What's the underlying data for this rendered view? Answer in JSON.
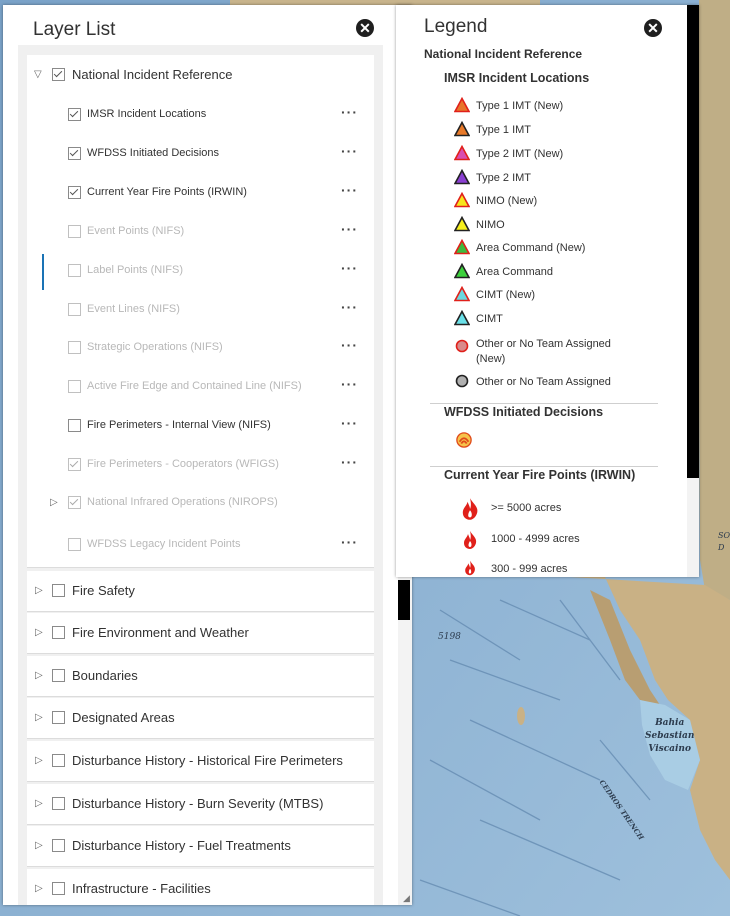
{
  "layer_list": {
    "title": "Layer List",
    "close_icon": "close-icon",
    "root": {
      "label": "National Incident Reference",
      "checked": true,
      "expanded": true,
      "children": [
        {
          "label": "IMSR Incident Locations",
          "checked": true,
          "dim": false,
          "menu": true
        },
        {
          "label": "WFDSS Initiated Decisions",
          "checked": true,
          "dim": false,
          "menu": true
        },
        {
          "label": "Current Year Fire Points (IRWIN)",
          "checked": true,
          "dim": false,
          "menu": true
        },
        {
          "label": "Event Points (NIFS)",
          "checked": false,
          "dim": true,
          "menu": true
        },
        {
          "label": "Label Points (NIFS)",
          "checked": false,
          "dim": true,
          "menu": true
        },
        {
          "label": "Event Lines (NIFS)",
          "checked": false,
          "dim": true,
          "menu": true
        },
        {
          "label": "Strategic Operations (NIFS)",
          "checked": false,
          "dim": true,
          "menu": true
        },
        {
          "label": "Active Fire Edge and Contained Line (NIFS)",
          "checked": false,
          "dim": true,
          "menu": true
        },
        {
          "label": "Fire Perimeters - Internal View (NIFS)",
          "checked": false,
          "dim": false,
          "menu": true
        },
        {
          "label": "Fire Perimeters - Cooperators (WFIGS)",
          "checked": true,
          "dim": true,
          "menu": true
        },
        {
          "label": "National Infrared Operations (NIROPS)",
          "checked": true,
          "dim": true,
          "menu": false
        },
        {
          "label": "WFDSS Legacy Incident Points",
          "checked": false,
          "dim": true,
          "menu": true
        }
      ]
    },
    "groups": [
      {
        "label": "Fire Safety"
      },
      {
        "label": "Fire Environment and Weather"
      },
      {
        "label": "Boundaries"
      },
      {
        "label": "Designated Areas"
      },
      {
        "label": "Disturbance History - Historical Fire Perimeters"
      },
      {
        "label": "Disturbance History - Burn Severity (MTBS)"
      },
      {
        "label": "Disturbance History - Fuel Treatments"
      },
      {
        "label": "Infrastructure - Facilities"
      }
    ],
    "menu_glyph": "···"
  },
  "legend": {
    "title": "Legend",
    "section": "National Incident Reference",
    "imsr": {
      "heading": "IMSR Incident Locations",
      "items": [
        {
          "label": "Type 1 IMT (New)",
          "fill": "#e8742a",
          "stroke": "#e0201a",
          "shape": "triangle"
        },
        {
          "label": "Type 1 IMT",
          "fill": "#e87a2a",
          "stroke": "#222222",
          "shape": "triangle"
        },
        {
          "label": "Type 2 IMT (New)",
          "fill": "#d94db0",
          "stroke": "#e0201a",
          "shape": "triangle"
        },
        {
          "label": "Type 2 IMT",
          "fill": "#8a3fd1",
          "stroke": "#222222",
          "shape": "triangle"
        },
        {
          "label": "NIMO (New)",
          "fill": "#f7e41c",
          "stroke": "#e0201a",
          "shape": "triangle"
        },
        {
          "label": "NIMO",
          "fill": "#f7f01c",
          "stroke": "#222222",
          "shape": "triangle"
        },
        {
          "label": "Area Command (New)",
          "fill": "#3dbb3d",
          "stroke": "#e0201a",
          "shape": "triangle"
        },
        {
          "label": "Area Command",
          "fill": "#3dd13d",
          "stroke": "#222222",
          "shape": "triangle"
        },
        {
          "label": "CIMT (New)",
          "fill": "#6ad9e0",
          "stroke": "#e0201a",
          "shape": "triangle"
        },
        {
          "label": "CIMT",
          "fill": "#6ae0e8",
          "stroke": "#222222",
          "shape": "triangle"
        },
        {
          "label": "Other or No Team Assigned (New)",
          "fill": "#d98a8a",
          "stroke": "#e0201a",
          "shape": "circle"
        },
        {
          "label": "Other or No Team Assigned",
          "fill": "#b0b0b0",
          "stroke": "#222222",
          "shape": "circle"
        }
      ]
    },
    "wfdss": {
      "heading": "WFDSS Initiated Decisions",
      "icon": "wfdss-decision-icon"
    },
    "irwin": {
      "heading": "Current Year Fire Points (IRWIN)",
      "items": [
        {
          "label": ">= 5000 acres"
        },
        {
          "label": "1000 - 4999 acres"
        },
        {
          "label": "300 - 999 acres"
        }
      ]
    }
  },
  "map": {
    "labels": [
      {
        "text": "5198",
        "name": "depth-label"
      },
      {
        "text": "Bahia\nSebastian\nViscaino",
        "name": "bay-label"
      },
      {
        "text": "CEDROS TRENCH",
        "name": "trench-label"
      },
      {
        "text": "SO\nD",
        "name": "edge-label"
      }
    ]
  }
}
